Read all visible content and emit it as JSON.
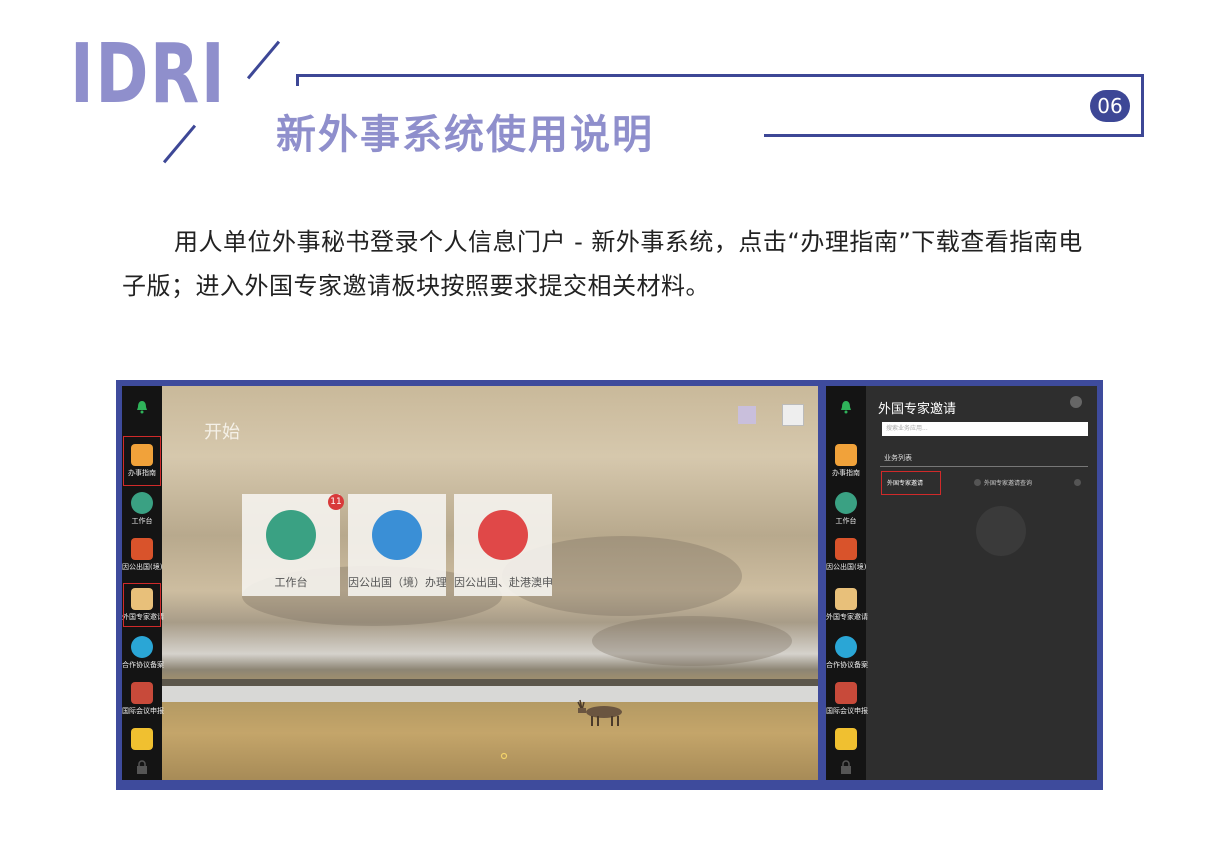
{
  "header": {
    "logo": "IDRI",
    "title": "新外事系统使用说明",
    "page_number": "06"
  },
  "body": {
    "paragraph": "用人单位外事秘书登录个人信息门户 - 新外事系统，点击“办理指南”下载查看指南电子版；进入外国专家邀请板块按照要求提交相关材料。"
  },
  "screenshot_left": {
    "start_label": "开始",
    "sidebar_items": [
      {
        "label": "办事指南",
        "icon": "flag-icon",
        "color": "#f1a23a"
      },
      {
        "label": "工作台",
        "icon": "dashboard-icon",
        "color": "#3aa183"
      },
      {
        "label": "因公出国(境)",
        "icon": "passport-icon",
        "color": "#d9532b"
      },
      {
        "label": "外国专家邀请",
        "icon": "expert-icon",
        "color": "#e8c07a"
      },
      {
        "label": "合作协议备案",
        "icon": "cloud-icon",
        "color": "#2aa6d6"
      },
      {
        "label": "国际会议申报",
        "icon": "meeting-icon",
        "color": "#c84a3a"
      },
      {
        "label": "",
        "icon": "admin-icon",
        "color": "#f0c030"
      }
    ],
    "tiles": [
      {
        "label": "工作台",
        "icon": "dashboard-icon",
        "color": "#3aa183"
      },
      {
        "label": "因公出国（境）办理指南",
        "icon": "paper-plane-icon",
        "color": "#3a8fd6"
      },
      {
        "label": "因公出国、赴港澳申报...",
        "icon": "map-pin-icon",
        "color": "#e04848"
      }
    ],
    "tile_badge": "11"
  },
  "screenshot_right": {
    "dialog_title": "外国专家邀请",
    "search_placeholder": "搜索业务应用...",
    "section_label": "业务列表",
    "items": [
      "外国专家邀请",
      "外国专家邀请查询"
    ],
    "sidebar_items": [
      {
        "label": "办事指南",
        "icon": "flag-icon",
        "color": "#f1a23a"
      },
      {
        "label": "工作台",
        "icon": "dashboard-icon",
        "color": "#3aa183"
      },
      {
        "label": "因公出国(境)",
        "icon": "passport-icon",
        "color": "#d9532b"
      },
      {
        "label": "外国专家邀请",
        "icon": "expert-icon",
        "color": "#e8c07a"
      },
      {
        "label": "合作协议备案",
        "icon": "cloud-icon",
        "color": "#2aa6d6"
      },
      {
        "label": "国际会议申报",
        "icon": "meeting-icon",
        "color": "#c84a3a"
      },
      {
        "label": "",
        "icon": "admin-icon",
        "color": "#f0c030"
      }
    ]
  },
  "colors": {
    "accent": "#3d4796",
    "logo": "#8f8fcc",
    "highlight": "#d02a2a"
  }
}
